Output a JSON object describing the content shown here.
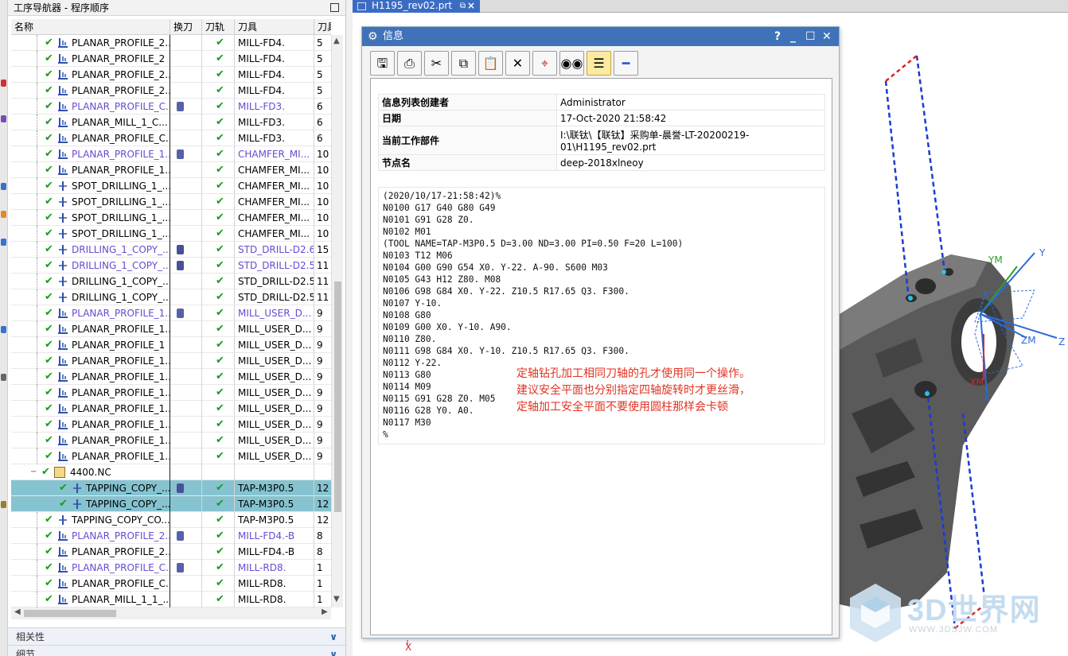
{
  "navigator": {
    "title": "工序导航器 - 程序顺序",
    "columns": [
      "名称",
      "换刀",
      "刀轨",
      "刀具",
      "刀具号"
    ],
    "rows": [
      {
        "name": "PLANAR_PROFILE_2...",
        "indent": 1,
        "op": "planar",
        "tool": "MILL-FD4.",
        "num": "5"
      },
      {
        "name": "PLANAR_PROFILE_2",
        "indent": 1,
        "op": "planar",
        "tool": "MILL-FD4.",
        "num": "5"
      },
      {
        "name": "PLANAR_PROFILE_2...",
        "indent": 1,
        "op": "planar",
        "tool": "MILL-FD4.",
        "num": "5"
      },
      {
        "name": "PLANAR_PROFILE_2...",
        "indent": 1,
        "op": "planar",
        "tool": "MILL-FD4.",
        "num": "5"
      },
      {
        "name": "PLANAR_PROFILE_C...",
        "indent": 1,
        "op": "planar",
        "tool": "MILL-FD3.",
        "num": "6",
        "purple": true,
        "toolchange": true
      },
      {
        "name": "PLANAR_MILL_1_C...",
        "indent": 1,
        "op": "planar",
        "tool": "MILL-FD3.",
        "num": "6"
      },
      {
        "name": "PLANAR_PROFILE_C...",
        "indent": 1,
        "op": "planar",
        "tool": "MILL-FD3.",
        "num": "6"
      },
      {
        "name": "PLANAR_PROFILE_1...",
        "indent": 1,
        "op": "planar",
        "tool": "CHAMFER_MI...",
        "num": "10",
        "purple": true,
        "toolchange": true
      },
      {
        "name": "PLANAR_PROFILE_1...",
        "indent": 1,
        "op": "planar",
        "tool": "CHAMFER_MI...",
        "num": "10"
      },
      {
        "name": "SPOT_DRILLING_1_...",
        "indent": 1,
        "op": "drill",
        "tool": "CHAMFER_MI...",
        "num": "10"
      },
      {
        "name": "SPOT_DRILLING_1_...",
        "indent": 1,
        "op": "drill",
        "tool": "CHAMFER_MI...",
        "num": "10"
      },
      {
        "name": "SPOT_DRILLING_1_...",
        "indent": 1,
        "op": "drill",
        "tool": "CHAMFER_MI...",
        "num": "10"
      },
      {
        "name": "SPOT_DRILLING_1_...",
        "indent": 1,
        "op": "drill",
        "tool": "CHAMFER_MI...",
        "num": "10"
      },
      {
        "name": "DRILLING_1_COPY_...",
        "indent": 1,
        "op": "drill",
        "tool": "STD_DRILL-D2.6",
        "num": "15",
        "purple": true,
        "toolchange": true,
        "drillicon": true
      },
      {
        "name": "DRILLING_1_COPY_...",
        "indent": 1,
        "op": "drill",
        "tool": "STD_DRILL-D2.5",
        "num": "11",
        "purple": true,
        "toolchange": true,
        "drillicon": true
      },
      {
        "name": "DRILLING_1_COPY_...",
        "indent": 1,
        "op": "drill",
        "tool": "STD_DRILL-D2.5",
        "num": "11"
      },
      {
        "name": "DRILLING_1_COPY_...",
        "indent": 1,
        "op": "drill",
        "tool": "STD_DRILL-D2.5",
        "num": "11"
      },
      {
        "name": "PLANAR_PROFILE_1...",
        "indent": 1,
        "op": "planar",
        "tool": "MILL_USER_D...",
        "num": "9",
        "purple": true,
        "toolchange": true
      },
      {
        "name": "PLANAR_PROFILE_1...",
        "indent": 1,
        "op": "planar",
        "tool": "MILL_USER_D...",
        "num": "9"
      },
      {
        "name": "PLANAR_PROFILE_1",
        "indent": 1,
        "op": "planar",
        "tool": "MILL_USER_D...",
        "num": "9"
      },
      {
        "name": "PLANAR_PROFILE_1...",
        "indent": 1,
        "op": "planar",
        "tool": "MILL_USER_D...",
        "num": "9"
      },
      {
        "name": "PLANAR_PROFILE_1...",
        "indent": 1,
        "op": "planar",
        "tool": "MILL_USER_D...",
        "num": "9"
      },
      {
        "name": "PLANAR_PROFILE_1...",
        "indent": 1,
        "op": "planar",
        "tool": "MILL_USER_D...",
        "num": "9"
      },
      {
        "name": "PLANAR_PROFILE_1...",
        "indent": 1,
        "op": "planar",
        "tool": "MILL_USER_D...",
        "num": "9"
      },
      {
        "name": "PLANAR_PROFILE_1...",
        "indent": 1,
        "op": "planar",
        "tool": "MILL_USER_D...",
        "num": "9"
      },
      {
        "name": "PLANAR_PROFILE_1...",
        "indent": 1,
        "op": "planar",
        "tool": "MILL_USER_D...",
        "num": "9"
      },
      {
        "name": "PLANAR_PROFILE_1...",
        "indent": 1,
        "op": "planar",
        "tool": "MILL_USER_D...",
        "num": "9"
      },
      {
        "name": "4400.NC",
        "indent": 0,
        "op": "group",
        "tool": "",
        "num": "",
        "group": true
      },
      {
        "name": "TAPPING_COPY_...",
        "indent": 2,
        "op": "drill",
        "tool": "TAP-M3P0.5",
        "num": "12",
        "selected": true,
        "toolchange": true,
        "drillicon": true
      },
      {
        "name": "TAPPING_COPY_...",
        "indent": 2,
        "op": "drill",
        "tool": "TAP-M3P0.5",
        "num": "12",
        "selected": true
      },
      {
        "name": "TAPPING_COPY_CO...",
        "indent": 1,
        "op": "drill",
        "tool": "TAP-M3P0.5",
        "num": "12"
      },
      {
        "name": "PLANAR_PROFILE_2...",
        "indent": 1,
        "op": "planar",
        "tool": "MILL-FD4.-B",
        "num": "8",
        "purple": true,
        "toolchange": true
      },
      {
        "name": "PLANAR_PROFILE_2...",
        "indent": 1,
        "op": "planar",
        "tool": "MILL-FD4.-B",
        "num": "8"
      },
      {
        "name": "PLANAR_PROFILE_C...",
        "indent": 1,
        "op": "planar",
        "tool": "MILL-RD8.",
        "num": "1",
        "purple": true,
        "toolchange": true
      },
      {
        "name": "PLANAR_PROFILE_C...",
        "indent": 1,
        "op": "planar",
        "tool": "MILL-RD8.",
        "num": "1"
      },
      {
        "name": "PLANAR_MILL_1_1_...",
        "indent": 1,
        "op": "planar",
        "tool": "MILL-RD8.",
        "num": "1"
      }
    ],
    "accordions": [
      "相关性",
      "细节"
    ]
  },
  "tab": {
    "label": "H1195_rev02.prt"
  },
  "dialog": {
    "title": "信息",
    "help": "?",
    "toolbar_icons": [
      "save-icon",
      "print-icon",
      "cut-icon",
      "copy-icon",
      "paste-icon",
      "delete-icon",
      "find-icon",
      "binoculars-icon",
      "wrap-icon",
      "minus-icon"
    ],
    "info_rows": [
      {
        "key": "信息列表创建者",
        "value": "Administrator"
      },
      {
        "key": "日期",
        "value": "17-Oct-2020 21:58:42"
      },
      {
        "key": "当前工作部件",
        "value": "I:\\联钛\\【联钛】采购单-晨誉-LT-20200219-\n01\\H1195_rev02.prt"
      },
      {
        "key": "节点名",
        "value": "deep-2018xlneoy"
      }
    ],
    "code_lines": [
      "(2020/10/17-21:58:42)%",
      "N0100 G17 G40 G80 G49",
      "N0101 G91 G28 Z0.",
      "N0102 M01",
      "(TOOL NAME=TAP-M3P0.5 D=3.00 ND=3.00 PI=0.50 F=20 L=100)",
      "N0103 T12 M06",
      "N0104 G00 G90 G54 X0. Y-22. A-90. S600 M03",
      "N0105 G43 H12 Z80. M08",
      "N0106 G98 G84 X0. Y-22. Z10.5 R17.65 Q3. F300.",
      "N0107 Y-10.",
      "N0108 G80",
      "N0109 G00 X0. Y-10. A90.",
      "N0110 Z80.",
      "N0111 G98 G84 X0. Y-10. Z10.5 R17.65 Q3. F300.",
      "N0112 Y-22.",
      "N0113 G80",
      "N0114 M09",
      "N0115 G91 G28 Z0. M05",
      "N0116 G28 Y0. A0.",
      "N0117 M30",
      "%"
    ],
    "note_lines": [
      "定轴钻孔加工相同刀轴的孔才使用同一个操作。",
      "建议安全平面也分别指定四轴旋转时才更丝滑，",
      "定轴加工安全平面不要使用圆柱那样会卡顿"
    ],
    "note_color": "#e23322"
  },
  "viewport": {
    "axis_labels": {
      "ym": "YM",
      "y": "Y",
      "zm": "ZM",
      "z": "Z",
      "x": "X",
      "xm": "XM",
      "origin_x": "X"
    }
  },
  "watermark": {
    "brand": "3D世界网",
    "url": "WWW.3DSJW.COM"
  },
  "colors": {
    "accent": "#3f72b8",
    "selected_row": "#86c3d0",
    "check": "#1a9b1a",
    "purple": "#6a4ad0"
  }
}
